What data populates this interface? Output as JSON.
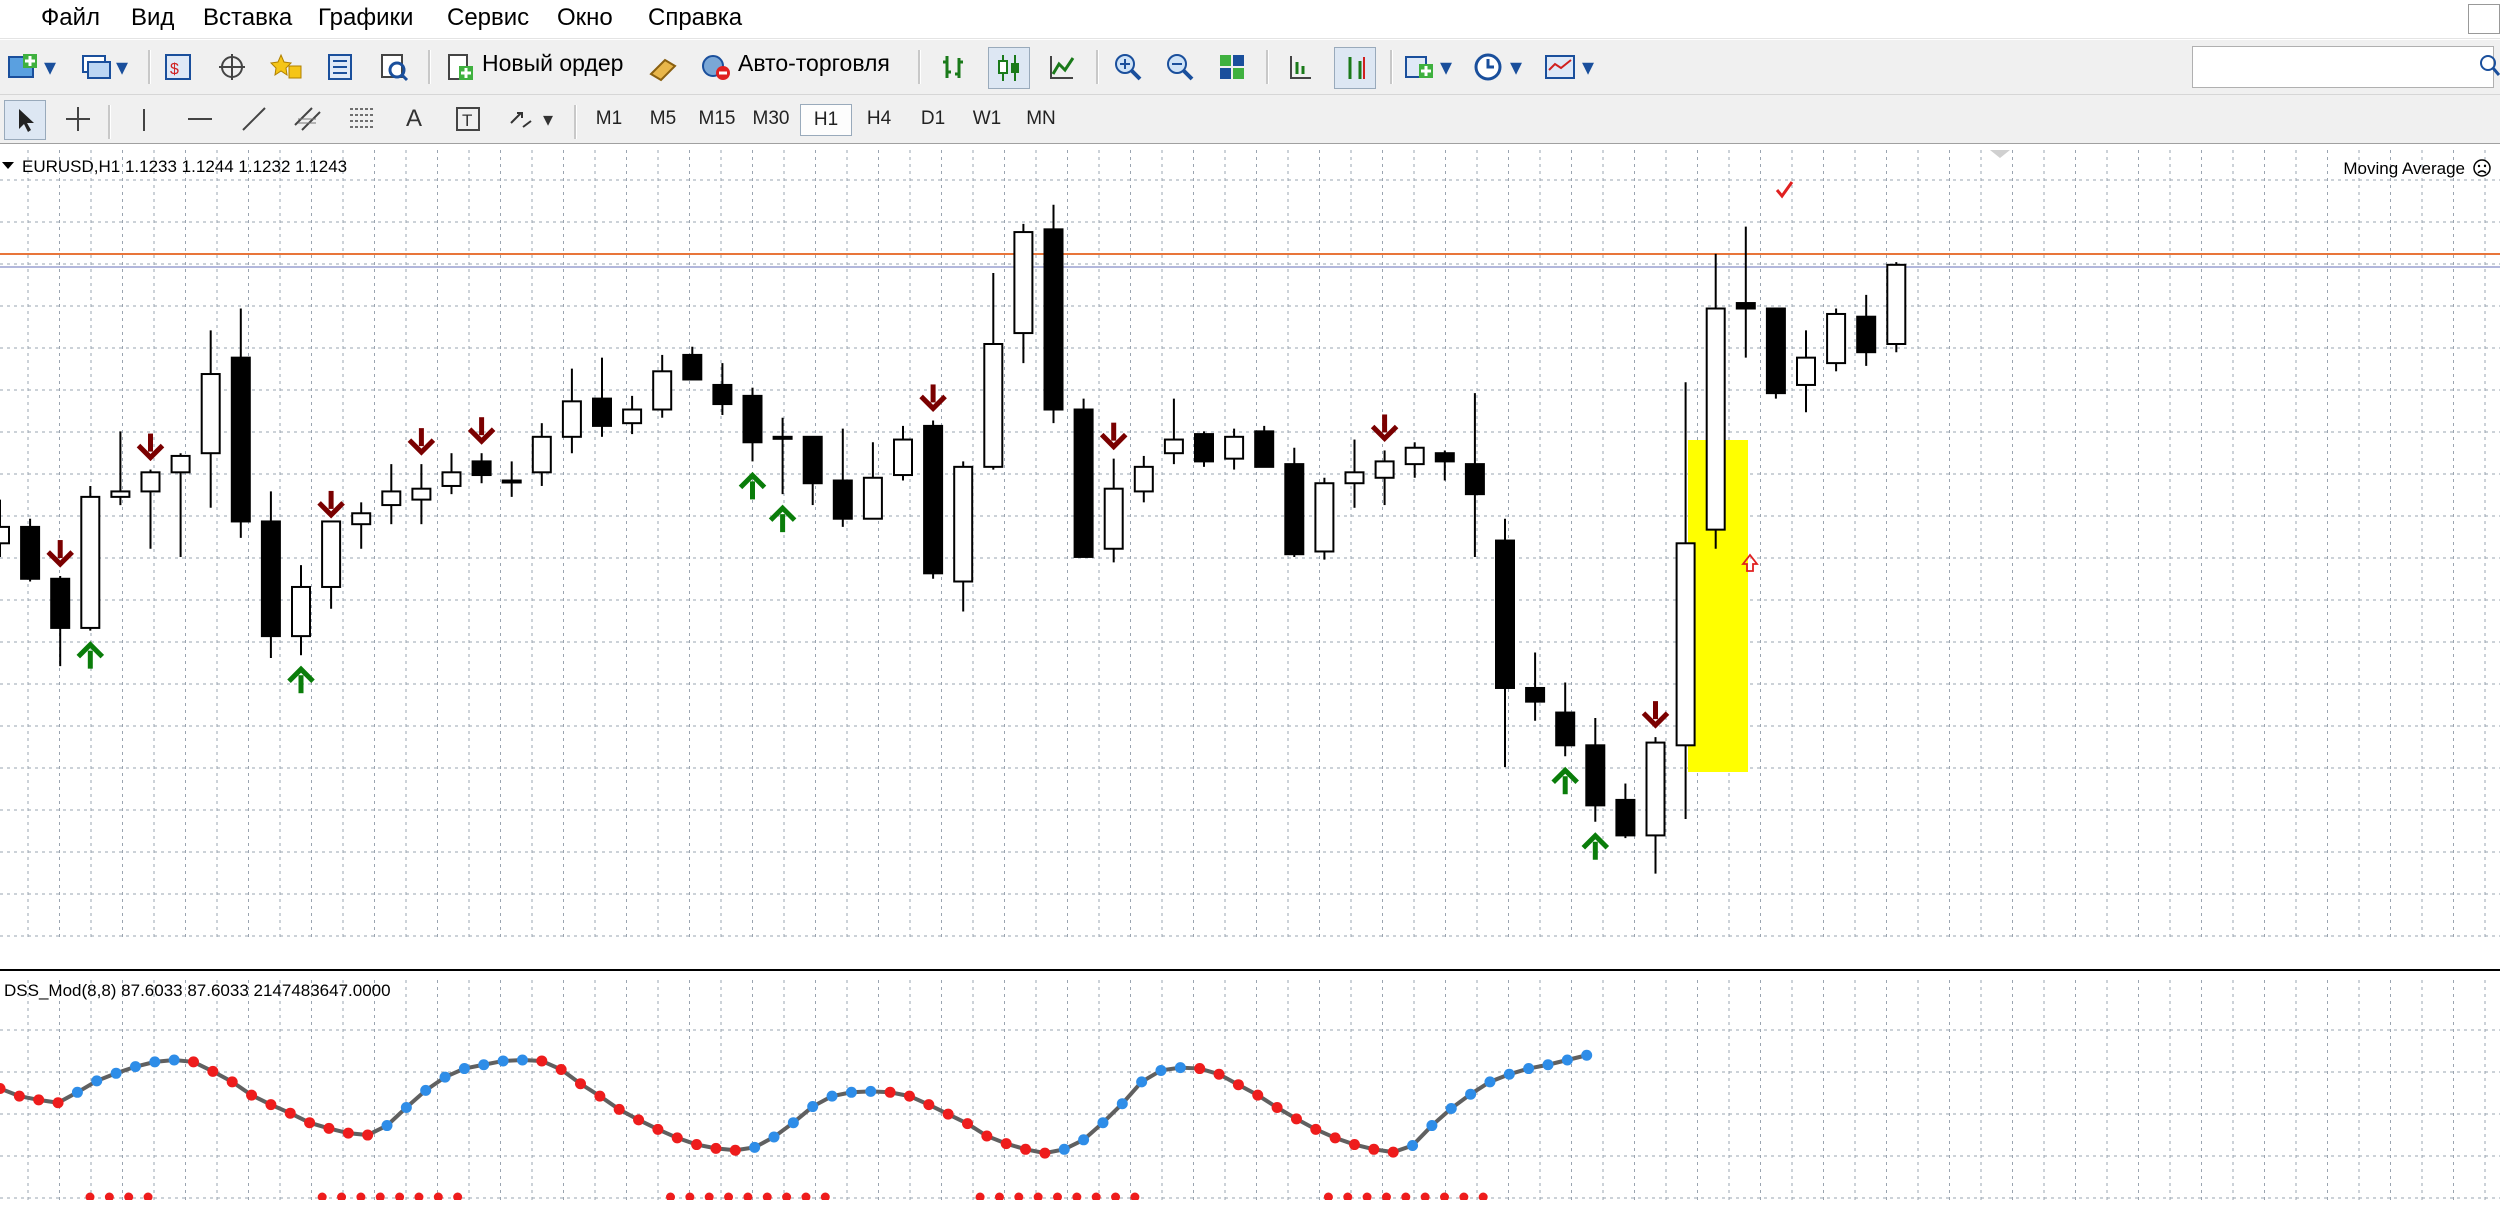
{
  "menu": [
    "Файл",
    "Вид",
    "Вставка",
    "Графики",
    "Сервис",
    "Окно",
    "Справка"
  ],
  "toolbar": {
    "new_order_label": "Новый ордер",
    "auto_trading_label": "Авто-торговля",
    "icons": [
      "new-chart-icon",
      "profiles-icon",
      "market-watch-icon",
      "navigator-icon",
      "favorites-icon",
      "data-window-icon",
      "terminal-icon",
      "new-order-icon",
      "signals-icon",
      "auto-trading-icon",
      "bar-chart-icon",
      "candlestick-icon",
      "line-chart-icon",
      "zoom-in-icon",
      "zoom-out-icon",
      "tile-windows-icon",
      "autoscroll-icon",
      "chart-shift-icon",
      "indicators-icon",
      "periods-icon",
      "templates-icon"
    ]
  },
  "draw_tools": [
    "cursor-icon",
    "crosshair-icon",
    "vertical-line-icon",
    "horizontal-line-icon",
    "trendline-icon",
    "equidistant-channel-icon",
    "fibonacci-icon",
    "text-icon",
    "text-label-icon",
    "arrows-icon"
  ],
  "timeframes": [
    "M1",
    "M5",
    "M15",
    "M30",
    "H1",
    "H4",
    "D1",
    "W1",
    "MN"
  ],
  "active_timeframe": "H1",
  "chart": {
    "info": "EURUSD,H1  1.1233 1.1244 1.1232 1.1243",
    "indicator_label": "Moving Average",
    "sub_info": "DSS_Mod(8,8) 87.6033 87.6033 2147483647.0000",
    "colors": {
      "bull_candle": "#ffffff",
      "bear_candle": "#000000",
      "buy_arrow": "#0a7d0a",
      "sell_arrow": "#7a0000",
      "level_line": "#e8753a",
      "highlight": "#ffff00",
      "dss_up": "#2e8de8",
      "dss_down": "#ee1c1c",
      "dss_line": "#606060"
    }
  },
  "chart_data": [
    {
      "type": "candlestick",
      "symbol": "EURUSD,H1",
      "candles": [
        [
          72.7,
          74.3,
          72.2,
          73.3
        ],
        [
          73.3,
          73.6,
          71.3,
          71.4
        ],
        [
          71.4,
          71.5,
          68.2,
          69.6
        ],
        [
          69.6,
          74.8,
          69.5,
          74.4
        ],
        [
          74.4,
          76.8,
          74.1,
          74.6
        ],
        [
          74.6,
          75.4,
          72.5,
          75.3
        ],
        [
          75.3,
          76.0,
          72.2,
          75.9
        ],
        [
          76.0,
          80.5,
          74.0,
          78.9
        ],
        [
          79.5,
          81.3,
          72.9,
          73.5
        ],
        [
          73.5,
          74.6,
          68.5,
          69.3
        ],
        [
          69.3,
          71.9,
          68.6,
          71.1
        ],
        [
          71.1,
          73.3,
          70.3,
          73.5
        ],
        [
          73.4,
          74.2,
          72.5,
          73.8
        ],
        [
          74.1,
          75.6,
          73.4,
          74.6
        ],
        [
          74.3,
          75.6,
          73.4,
          74.7
        ],
        [
          74.8,
          76.0,
          74.5,
          75.3
        ],
        [
          75.7,
          76.0,
          74.9,
          75.2
        ],
        [
          75.0,
          75.7,
          74.4,
          75.0
        ],
        [
          75.3,
          77.1,
          74.8,
          76.6
        ],
        [
          76.6,
          79.1,
          76.0,
          77.9
        ],
        [
          78.0,
          79.5,
          76.6,
          77.0
        ],
        [
          77.1,
          78.1,
          76.7,
          77.6
        ],
        [
          77.6,
          79.6,
          77.3,
          79.0
        ],
        [
          79.6,
          79.9,
          78.9,
          78.7
        ],
        [
          78.5,
          79.3,
          77.4,
          77.8
        ],
        [
          78.1,
          78.4,
          75.7,
          76.4
        ],
        [
          76.6,
          77.3,
          74.5,
          76.6
        ],
        [
          76.6,
          76.4,
          74.1,
          74.9
        ],
        [
          75.0,
          76.9,
          73.3,
          73.6
        ],
        [
          73.6,
          76.4,
          73.6,
          75.1
        ],
        [
          75.2,
          77.0,
          75.0,
          76.5
        ],
        [
          77.0,
          77.2,
          71.4,
          71.6
        ],
        [
          71.3,
          75.7,
          70.2,
          75.5
        ],
        [
          75.5,
          82.6,
          75.4,
          80.0
        ],
        [
          80.4,
          84.4,
          79.3,
          84.1
        ],
        [
          84.2,
          85.1,
          77.1,
          77.6
        ],
        [
          77.6,
          78.0,
          72.2,
          72.2
        ],
        [
          72.5,
          75.8,
          72.0,
          74.7
        ],
        [
          74.6,
          75.9,
          74.2,
          75.5
        ],
        [
          76.0,
          78.0,
          75.6,
          76.5
        ],
        [
          76.7,
          76.8,
          75.5,
          75.7
        ],
        [
          75.8,
          76.9,
          75.4,
          76.6
        ],
        [
          76.8,
          77.0,
          75.7,
          75.5
        ],
        [
          75.6,
          76.2,
          72.2,
          72.3
        ],
        [
          72.4,
          75.1,
          72.1,
          74.9
        ],
        [
          74.9,
          76.5,
          74.0,
          75.3
        ],
        [
          75.1,
          76.1,
          74.1,
          75.7
        ],
        [
          75.6,
          76.4,
          75.1,
          76.2
        ],
        [
          76.0,
          76.1,
          75.0,
          75.7
        ],
        [
          75.6,
          78.2,
          72.2,
          74.5
        ],
        [
          72.8,
          73.6,
          64.5,
          67.4
        ],
        [
          67.4,
          68.7,
          66.2,
          66.9
        ],
        [
          66.5,
          67.6,
          64.9,
          65.3
        ],
        [
          65.3,
          66.3,
          62.5,
          63.1
        ],
        [
          63.3,
          63.9,
          61.9,
          62.0
        ],
        [
          62.0,
          65.6,
          60.6,
          65.4
        ],
        [
          65.3,
          78.6,
          62.6,
          72.7
        ],
        [
          73.2,
          83.3,
          72.5,
          81.3
        ],
        [
          81.5,
          84.3,
          79.5,
          81.3
        ],
        [
          81.3,
          81.3,
          78.0,
          78.2
        ],
        [
          78.5,
          80.5,
          77.5,
          79.5
        ],
        [
          79.3,
          81.3,
          79.0,
          81.1
        ],
        [
          81.0,
          81.8,
          79.2,
          79.7
        ],
        [
          80.0,
          83.0,
          79.7,
          82.9
        ]
      ],
      "sell_arrow_indices": [
        2,
        5,
        11,
        14,
        16,
        31,
        37,
        46,
        55
      ],
      "buy_arrow_indices": [
        3,
        10,
        25,
        26,
        52,
        53
      ]
    },
    {
      "type": "line",
      "name": "DSS_Mod(8,8)",
      "ylim": [
        0,
        100
      ],
      "values": [
        70,
        62,
        58,
        55,
        66,
        78,
        86,
        93,
        98,
        100,
        98,
        88,
        77,
        63,
        53,
        44,
        34,
        28,
        23,
        21,
        31,
        50,
        68,
        82,
        91,
        95,
        99,
        100,
        99,
        90,
        75,
        62,
        48,
        37,
        27,
        18,
        11,
        7,
        5,
        8,
        19,
        34,
        51,
        62,
        66,
        67,
        66,
        62,
        53,
        43,
        33,
        20,
        12,
        6,
        2,
        6,
        16,
        34,
        54,
        77,
        89,
        92,
        91,
        85,
        74,
        63,
        50,
        38,
        27,
        18,
        11,
        6,
        3,
        10,
        31,
        49,
        64,
        77,
        85,
        91,
        95,
        100,
        105
      ]
    }
  ]
}
